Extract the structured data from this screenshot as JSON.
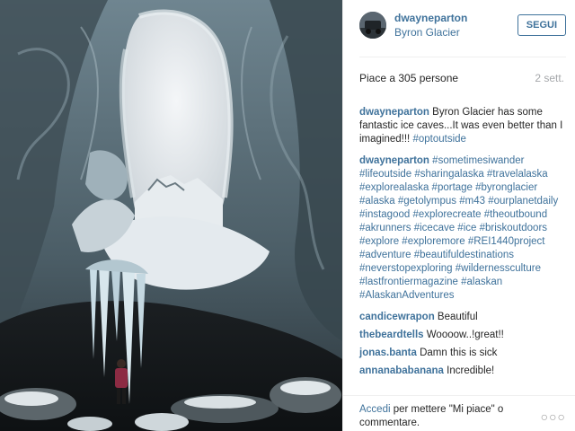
{
  "post": {
    "image_alt": "Ice cave at Byron Glacier with person standing under icicles"
  },
  "header": {
    "username": "dwayneparton",
    "location": "Byron Glacier",
    "follow_label": "SEGUI"
  },
  "stats": {
    "likes": "Piace a 305 persone",
    "age": "2 sett."
  },
  "comments": [
    {
      "user": "dwayneparton",
      "text": "Byron Glacier has some fantastic ice caves...It was even better than I imagined!!! ",
      "tags": "#optoutside"
    },
    {
      "user": "dwayneparton",
      "text": "",
      "tags": "#sometimesiwander #lifeoutside #sharingalaska #travelalaska #explorealaska #portage #byronglacier #alaska #getolympus #m43 #ourplanetdaily #instagood #explorecreate #theoutbound #akrunners #icecave #ice #briskoutdoors #explore #exploremore #REI1440project #adventure #beautifuldestinations #neverstopexploring #wildernessculture #lastfrontiermagazine #alaskan #AlaskanAdventures"
    },
    {
      "user": "candicewrapon",
      "text": "Beautiful",
      "tags": ""
    },
    {
      "user": "thebeardtells",
      "text": "Woooow..!great!!",
      "tags": ""
    },
    {
      "user": "jonas.banta",
      "text": "Damn this is sick",
      "tags": ""
    },
    {
      "user": "annanababanana",
      "text": "Incredible!",
      "tags": ""
    }
  ],
  "footer": {
    "login_link": "Accedi",
    "login_text": " per mettere \"Mi piace\" o commentare.",
    "more_icon": "ellipsis-icon",
    "more_glyph": "○○○"
  },
  "colors": {
    "link": "#3f729b",
    "text": "#262626",
    "muted": "#a5a7aa"
  }
}
